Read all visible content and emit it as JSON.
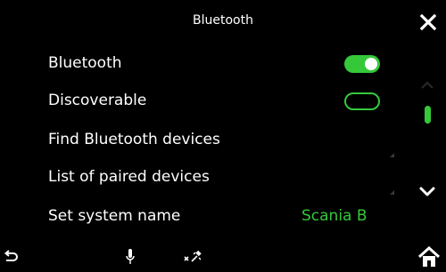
{
  "header": {
    "title": "Bluetooth",
    "close_icon": "close-icon"
  },
  "menu": {
    "items": [
      {
        "label": "Bluetooth",
        "control": "toggle",
        "state": "on"
      },
      {
        "label": "Discoverable",
        "control": "toggle",
        "state": "off"
      },
      {
        "label": "Find Bluetooth devices"
      },
      {
        "label": "List of paired devices"
      },
      {
        "label": "Set system name",
        "value": "Scania B"
      }
    ]
  },
  "scroll": {
    "up_icon": "chevron-up-icon",
    "down_icon": "chevron-down-icon"
  },
  "bottom_bar": {
    "icons": [
      "back-icon",
      "microphone-icon",
      "satellite-off-icon",
      "home-icon"
    ]
  },
  "colors": {
    "accent": "#35c93a",
    "background": "#000000",
    "text": "#ffffff",
    "dim": "#3a3a3a"
  }
}
